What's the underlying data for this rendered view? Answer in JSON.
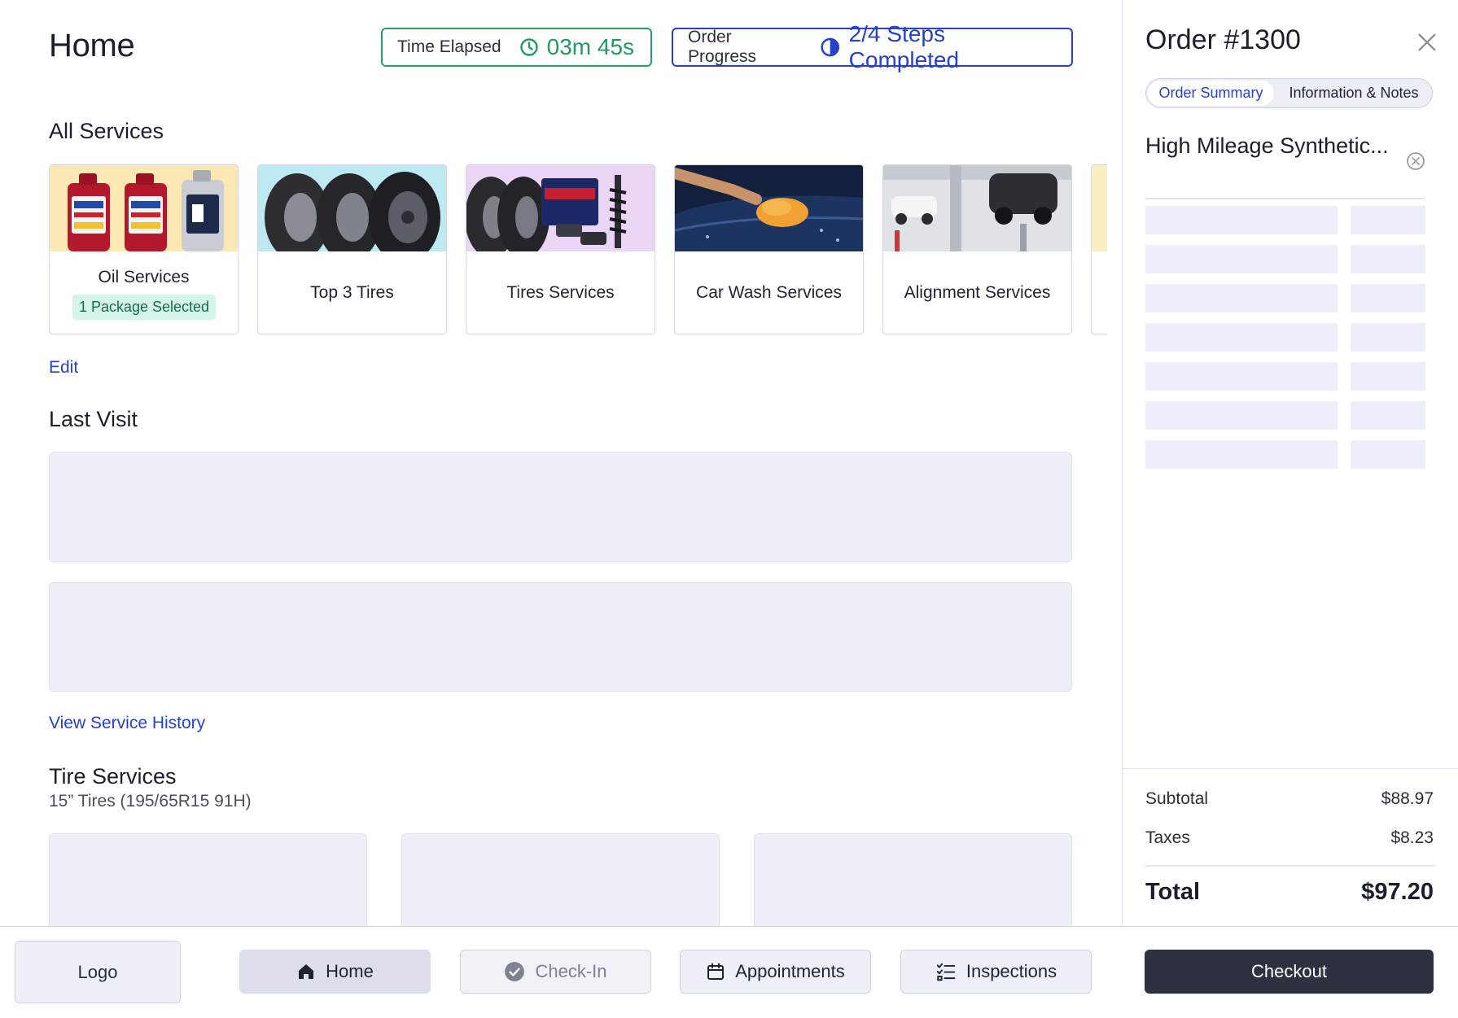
{
  "header": {
    "title": "Home",
    "time_elapsed": {
      "label": "Time Elapsed",
      "value": "03m 45s"
    },
    "order_progress": {
      "label": "Order Progress",
      "value": "2/4 Steps Completed"
    }
  },
  "all_services": {
    "title": "All Services",
    "cards": [
      {
        "label": "Oil Services",
        "badge": "1 Package Selected"
      },
      {
        "label": "Top 3 Tires"
      },
      {
        "label": "Tires Services"
      },
      {
        "label": "Car Wash Services"
      },
      {
        "label": "Alignment Services"
      }
    ],
    "edit_link": "Edit"
  },
  "last_visit": {
    "title": "Last Visit",
    "history_link": "View Service History"
  },
  "tire_services": {
    "title": "Tire Services",
    "subtitle": "15” Tires (195/65R15 91H)"
  },
  "order": {
    "title": "Order #1300",
    "tabs": [
      {
        "label": "Order Summary"
      },
      {
        "label": "Information & Notes"
      }
    ],
    "item_name": "High Mileage Synthetic...",
    "subtotal_label": "Subtotal",
    "subtotal_value": "$88.97",
    "taxes_label": "Taxes",
    "taxes_value": "$8.23",
    "total_label": "Total",
    "total_value": "$97.20"
  },
  "bottom_nav": {
    "logo": "Logo",
    "home": "Home",
    "checkin": "Check-In",
    "appointments": "Appointments",
    "inspections": "Inspections",
    "checkout": "Checkout"
  },
  "colors": {
    "accent_blue": "#2741c9",
    "accent_green": "#1f9a63",
    "badge_bg": "#d5f5e8",
    "checkout_bg": "#2e3240",
    "skeleton": "#eef0f8"
  }
}
